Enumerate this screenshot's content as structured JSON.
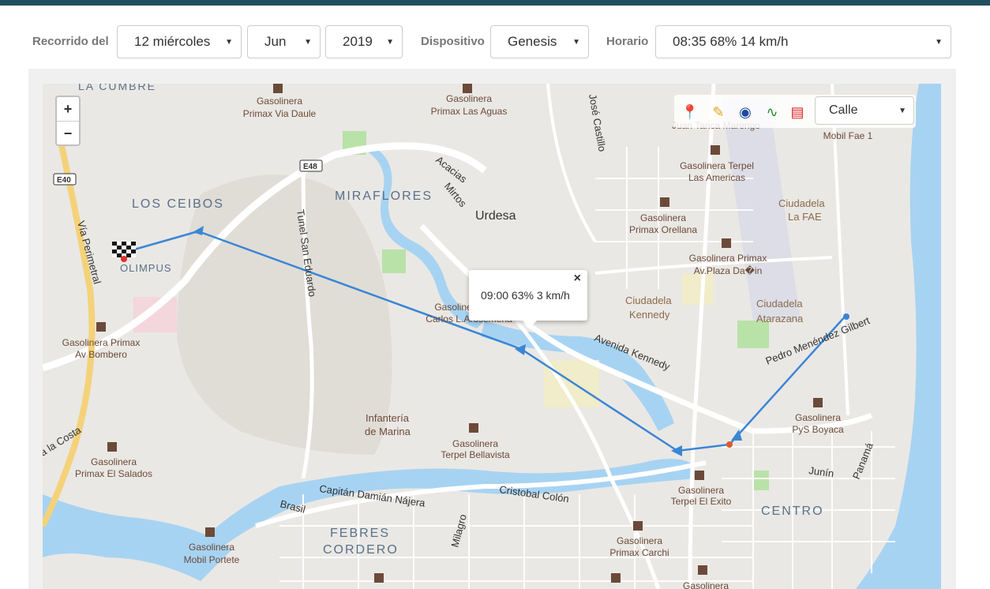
{
  "filters": {
    "recorrido_label": "Recorrido del",
    "day": "12 miércoles",
    "month": "Jun",
    "year": "2019",
    "dispositivo_label": "Dispositivo",
    "device": "Genesis",
    "horario_label": "Horario",
    "schedule": "08:35 68% 14 km/h"
  },
  "map": {
    "zoom_in": "+",
    "zoom_out": "−",
    "layer_select": "Calle",
    "popup_text": "09:00 63% 3 km/h",
    "popup_close": "×",
    "colors": {
      "route": "#3a86d6",
      "water": "#a7d3f2",
      "park": "#b9e2a8",
      "road": "#ffffff"
    },
    "tool_icons": [
      "pins-icon",
      "paint-icon",
      "globe-icon",
      "route-icon",
      "pdf-icon"
    ],
    "labels": {
      "la_cumbre": "LA CUMBRE",
      "los_ceibos": "LOS CEIBOS",
      "olimpus": "OLIMPUS",
      "miraflores": "MIRAFLORES",
      "urdesa": "Urdesa",
      "febres": "FEBRES",
      "cordero": "CORDERO",
      "centro": "CENTRO",
      "infanteria_1": "Infantería",
      "infanteria_2": "de Marina",
      "ciudadela_kennedy_1": "Ciudadela",
      "ciudadela_kennedy_2": "Kennedy",
      "ciudadela_fae_1": "Ciudadela",
      "ciudadela_fae_2": "La FAE",
      "ciudadela_atarazana_1": "Ciudadela",
      "ciudadela_atarazana_2": "Atarazana",
      "via_perimetral": "Vía Perimetral",
      "tunel": "Tunel San Eduardo",
      "avenida_kennedy": "Avenida Kennedy",
      "pedro_menendez": "Pedro Menéndez Gilbert",
      "capitan": "Capitán Damián Nájera",
      "cristobal": "Cristobal Colón",
      "milagro": "Milagro",
      "junin": "Junín",
      "panama": "Panamá",
      "brasil": "Brasil",
      "jose_castillo": "José Castillo",
      "acacias": "Acacias",
      "mirtos": "Mirtos",
      "la_costa": "a la Costa",
      "e40": "E40",
      "e48": "E48",
      "gas_primax_via_daule_1": "Gasolinera",
      "gas_primax_via_daule_2": "Primax Via Daule",
      "gas_primax_las_aguas_1": "Gasolinera",
      "gas_primax_las_aguas_2": "Primax Las Aguas",
      "gas_juan_tanca": "Juan Tanca Marengo",
      "gas_terpel_americas_1": "Gasolinera Terpel",
      "gas_terpel_americas_2": "Las Americas",
      "gas_mobil_fae": "Mobil Fae 1",
      "gas_primax_orellana_1": "Gasolinera",
      "gas_primax_orellana_2": "Primax Orellana",
      "gas_primax_plaza_1": "Gasolinera Primax",
      "gas_primax_plaza_2": "Av.Plaza Da�in",
      "gas_carlos_1": "Gasoline",
      "gas_carlos_2": "Carlos L.Arosemena",
      "gas_primax_bombero_1": "Gasolinera Primax",
      "gas_primax_bombero_2": "Av Bombero",
      "gas_terpel_bellavista_1": "Gasolinera",
      "gas_terpel_bellavista_2": "Terpel Bellavista",
      "gas_pys_boyaca_1": "Gasolinera",
      "gas_pys_boyaca_2": "PyS Boyaca",
      "gas_primax_salados_1": "Gasolinera",
      "gas_primax_salados_2": "Primax El Salados",
      "gas_terpel_exito_1": "Gasolinera",
      "gas_terpel_exito_2": "Terpel El Exito",
      "gas_mobil_portete_1": "Gasolinera",
      "gas_mobil_portete_2": "Mobil Portete",
      "gas_primax_carchi_1": "Gasolinera",
      "gas_primax_carchi_2": "Primax Carchi",
      "gas_bottom": "Gasolinera"
    }
  }
}
